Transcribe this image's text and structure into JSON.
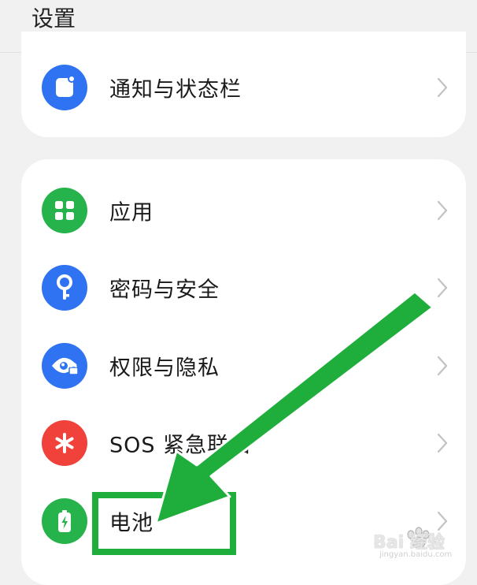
{
  "header": {
    "title": "设置"
  },
  "sections": [
    {
      "items": [
        {
          "label": "通知与状态栏",
          "icon": "notification-icon",
          "color": "#2f73f2"
        }
      ]
    },
    {
      "items": [
        {
          "label": "应用",
          "icon": "apps-grid-icon",
          "color": "#27b34b"
        },
        {
          "label": "密码与安全",
          "icon": "key-icon",
          "color": "#2f73f2"
        },
        {
          "label": "权限与隐私",
          "icon": "privacy-eye-icon",
          "color": "#2f73f2"
        },
        {
          "label": "SOS 紧急联络",
          "icon": "sos-asterisk-icon",
          "color": "#f0413a"
        },
        {
          "label": "电池",
          "icon": "battery-icon",
          "color": "#27b34b"
        }
      ]
    }
  ],
  "annotation": {
    "color": "#1fae3c"
  },
  "watermark": {
    "text": "Bai 经验",
    "sub": "jingyan.baidu.com"
  }
}
